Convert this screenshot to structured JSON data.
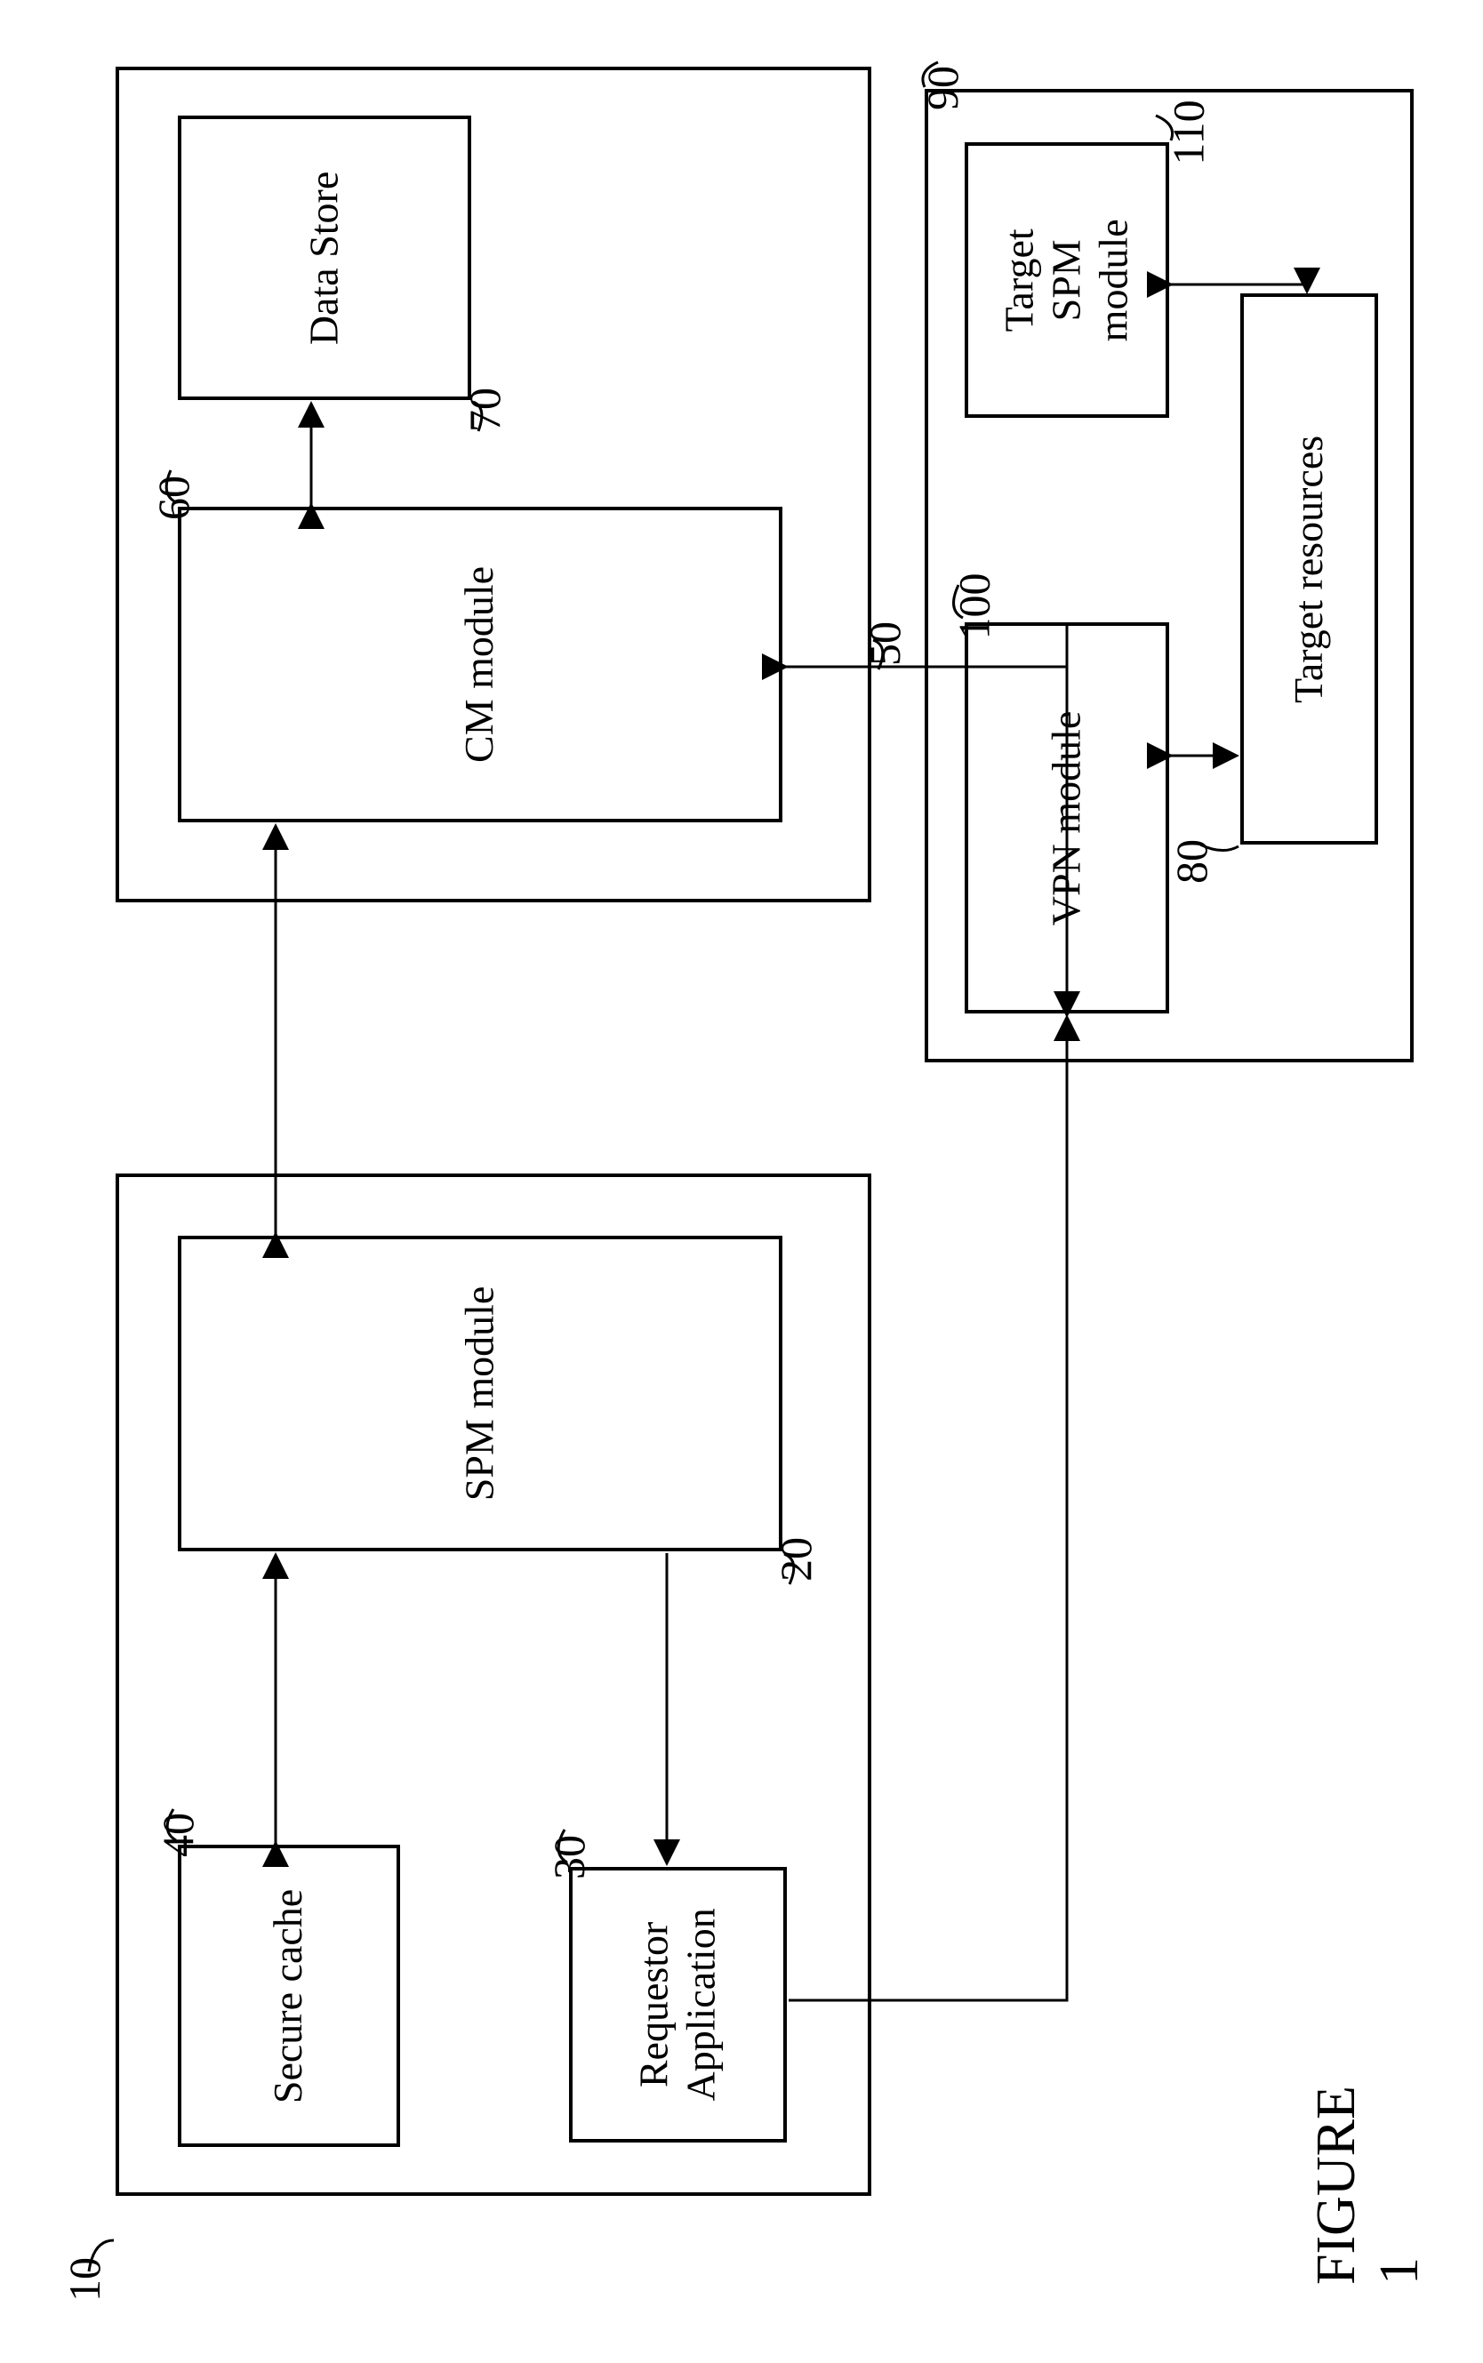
{
  "figure_label": "FIGURE 1",
  "blocks": {
    "requestor": {
      "label": "10",
      "secure_cache": {
        "text": "Secure cache",
        "label": "40"
      },
      "spm_module": {
        "text": "SPM  module",
        "label": "20"
      },
      "requestor_app": {
        "text": "Requestor\nApplication",
        "label": "30"
      }
    },
    "cm": {
      "label": "50",
      "cm_module": {
        "text": "CM module",
        "label": "60"
      },
      "data_store": {
        "text": "Data Store",
        "label": "70"
      }
    },
    "target": {
      "label": "90",
      "vpn_module": {
        "text": "VPN module",
        "label": "100"
      },
      "target_spm": {
        "text": "Target\nSPM\nmodule",
        "label": "110"
      },
      "target_resources": {
        "text": "Target resources",
        "label": "80"
      }
    }
  }
}
